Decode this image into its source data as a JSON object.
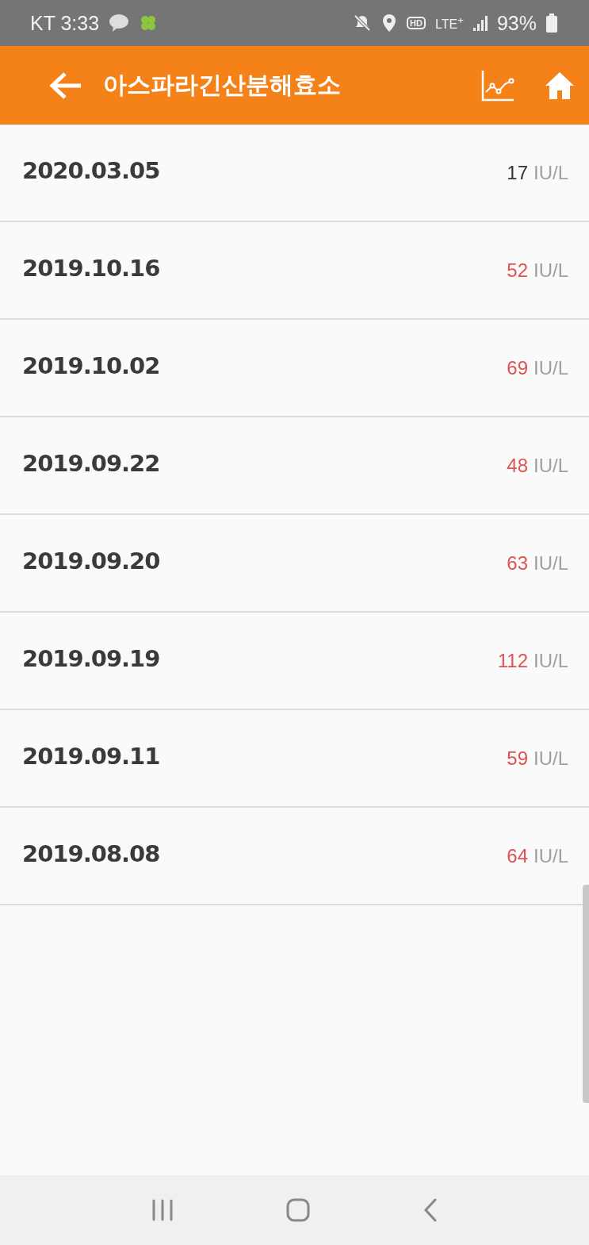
{
  "status_bar": {
    "carrier_time": "KT 3:33",
    "hd": "HD",
    "network": "LTE$^{+}$",
    "battery": "93%"
  },
  "header": {
    "title": "아스파라긴산분해효소"
  },
  "records": [
    {
      "date": "2020.03.05",
      "value": "17",
      "unit": "IU/L",
      "color": "#333333"
    },
    {
      "date": "2019.10.16",
      "value": "52",
      "unit": "IU/L",
      "color": "#e05252"
    },
    {
      "date": "2019.10.02",
      "value": "69",
      "unit": "IU/L",
      "color": "#e05252"
    },
    {
      "date": "2019.09.22",
      "value": "48",
      "unit": "IU/L",
      "color": "#e05252"
    },
    {
      "date": "2019.09.20",
      "value": "63",
      "unit": "IU/L",
      "color": "#e05252"
    },
    {
      "date": "2019.09.19",
      "value": "112",
      "unit": "IU/L",
      "color": "#e05252"
    },
    {
      "date": "2019.09.11",
      "value": "59",
      "unit": "IU/L",
      "color": "#e05252"
    },
    {
      "date": "2019.08.08",
      "value": "64",
      "unit": "IU/L",
      "color": "#e05252"
    }
  ]
}
